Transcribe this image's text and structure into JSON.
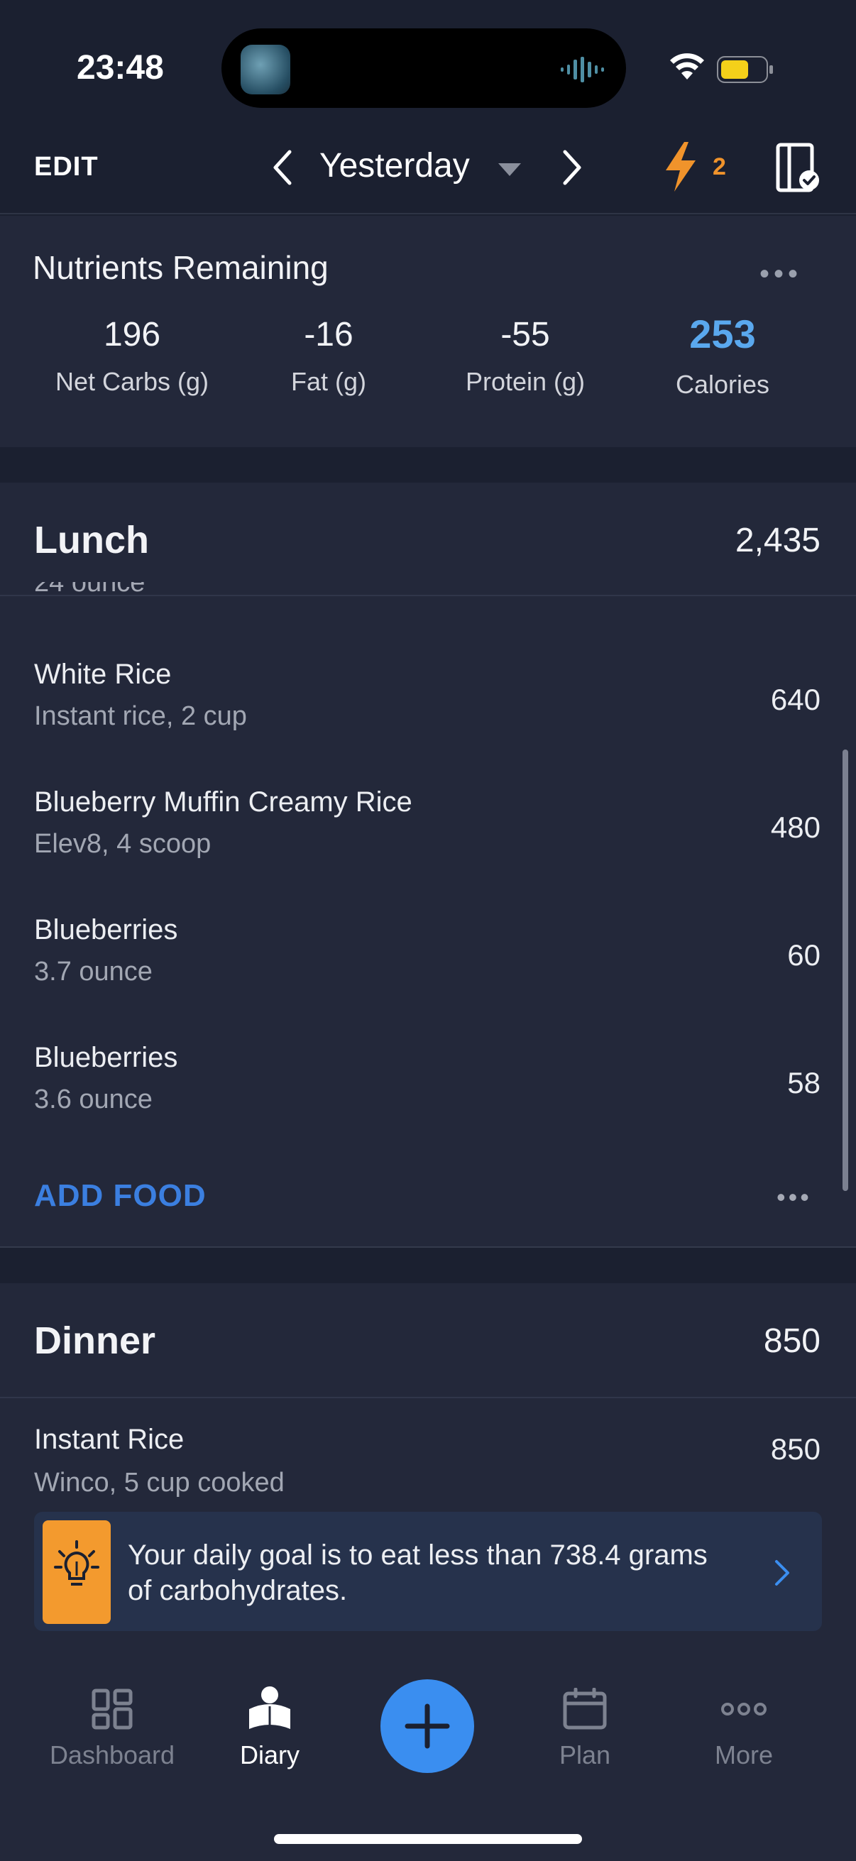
{
  "status_bar": {
    "time": "23:48"
  },
  "header": {
    "edit_label": "EDIT",
    "day_label": "Yesterday",
    "streak_count": "2",
    "accent_color": "#f0932b"
  },
  "nutrients": {
    "title": "Nutrients Remaining",
    "more_label": "•••",
    "items": [
      {
        "value": "196",
        "label": "Net Carbs (g)"
      },
      {
        "value": "-16",
        "label": "Fat (g)"
      },
      {
        "value": "-55",
        "label": "Protein (g)"
      },
      {
        "value": "253",
        "label": "Calories"
      }
    ],
    "calories_color": "#5aa8ee"
  },
  "lunch": {
    "title": "Lunch",
    "total": "2,435",
    "clipped_detail": "24 ounce",
    "foods": [
      {
        "name": "White Rice",
        "detail": "Instant rice, 2 cup",
        "calories": "640"
      },
      {
        "name": "Blueberry Muffin Creamy Rice",
        "detail": "Elev8, 4 scoop",
        "calories": "480"
      },
      {
        "name": "Blueberries",
        "detail": "3.7 ounce",
        "calories": "60"
      },
      {
        "name": "Blueberries",
        "detail": "3.6 ounce",
        "calories": "58"
      }
    ],
    "add_food_label": "ADD FOOD",
    "more_label": "•••"
  },
  "dinner": {
    "title": "Dinner",
    "total": "850",
    "foods": [
      {
        "name": "Instant Rice",
        "detail": "Winco, 5 cup cooked",
        "calories": "850"
      }
    ]
  },
  "banner": {
    "text": "Your daily goal is to eat less than 738.4 grams of carbohydrates.",
    "icon": "lightbulb-icon"
  },
  "tabbar": {
    "tabs": [
      {
        "label": "Dashboard",
        "icon": "dashboard-icon"
      },
      {
        "label": "Diary",
        "icon": "diary-icon",
        "active": true
      },
      {
        "label": "Plan",
        "icon": "calendar-icon"
      },
      {
        "label": "More",
        "icon": "more-icon"
      }
    ],
    "fab_icon": "plus-icon"
  }
}
